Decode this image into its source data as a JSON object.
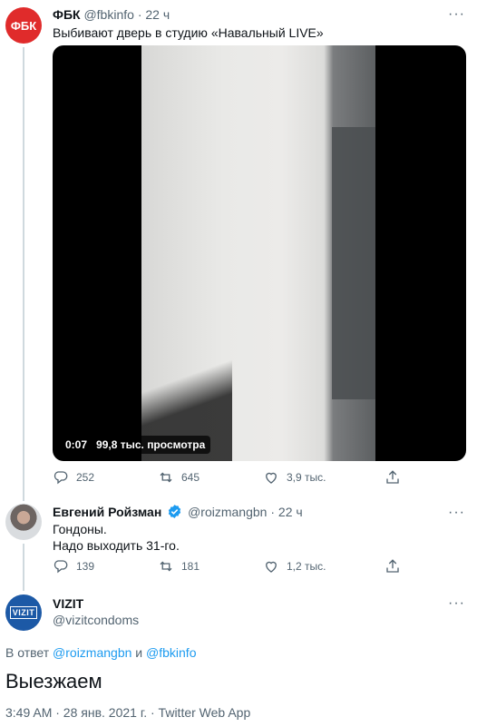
{
  "tweet1": {
    "avatar_text": "ФБК",
    "name": "ФБК",
    "handle": "@fbkinfo",
    "separator": "·",
    "time": "22 ч",
    "text": "Выбивают дверь в студию «Навальный LIVE»",
    "video": {
      "duration": "0:07",
      "views": "99,8 тыс. просмотра"
    },
    "replies": "252",
    "retweets": "645",
    "likes": "3,9 тыс."
  },
  "tweet2": {
    "name": "Евгений Ройзман",
    "handle": "@roizmangbn",
    "separator": "·",
    "time": "22 ч",
    "text_line1": "Гондоны.",
    "text_line2": "Надо выходить 31-го.",
    "replies": "139",
    "retweets": "181",
    "likes": "1,2 тыс."
  },
  "main_tweet": {
    "avatar_text": "VIZIT",
    "name": "VIZIT",
    "handle": "@vizitcondoms",
    "reply_prefix": "В ответ",
    "reply_user1": "@roizmangbn",
    "reply_and": "и",
    "reply_user2": "@fbkinfo",
    "text": "Выезжаем",
    "meta": "3:49 AM · 28 янв. 2021 г. · Twitter Web App"
  },
  "more_label": "···",
  "colors": {
    "fbk_red": "#e02b2b",
    "vizit_blue": "#1c59a6",
    "link": "#1d9bf0",
    "gray": "#536471",
    "verified": "#1d9bf0"
  }
}
